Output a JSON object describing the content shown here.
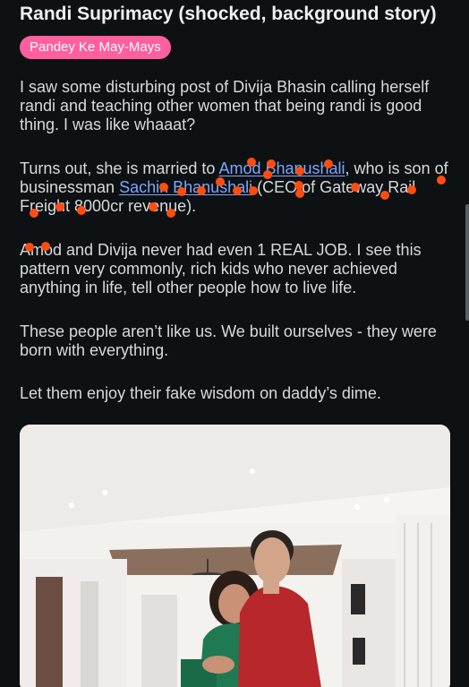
{
  "post": {
    "title": "Randi Suprimacy (shocked, background story)",
    "flair": "Pandey Ke May-Mays",
    "paragraphs": {
      "p1": "I saw some disturbing post of Divija Bhasin calling herself randi and teaching other women that being randi is good thing. I was like whaaat?",
      "p2_before": "Turns out, she is married to ",
      "p2_link1": "Amod Bhanushali",
      "p2_mid1": ", who is son of businessman ",
      "p2_link2": "Sachin Bhanushali",
      "p2_after": " (CEO of Gateway Rail Freight 8000cr revenue).",
      "p3": "Amod and Divija never had even 1 REAL JOB. I see this pattern very commonly, rich kids who never achieved anything in life, tell other people how to live life.",
      "p4": "These people aren’t like us. We built ourselves - they were born with everything.",
      "p5": "Let them enjoy their fake wisdom on daddy’s dime."
    }
  },
  "colors": {
    "background": "#0e1113",
    "flair": "#ff5f9e",
    "link": "#7aa7ff",
    "annotation_dots": "#ff4d12"
  }
}
